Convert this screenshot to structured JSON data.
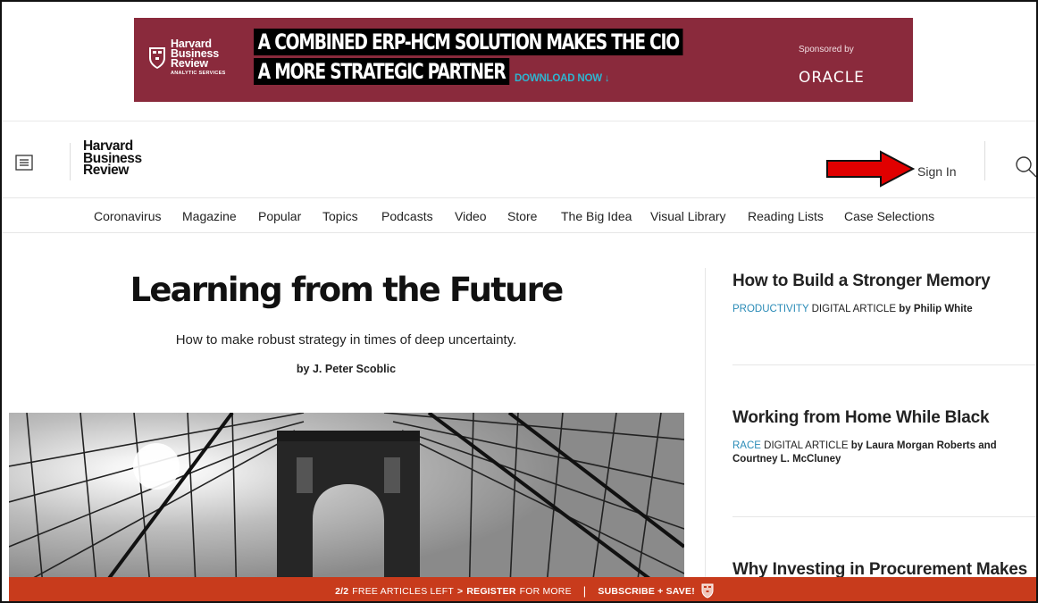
{
  "ad": {
    "logo_lines": [
      "Harvard",
      "Business",
      "Review"
    ],
    "logo_sub": "ANALYTIC SERVICES",
    "headline_line1": "A COMBINED ERP-HCM SOLUTION MAKES THE CIO",
    "headline_line2": "A MORE STRATEGIC PARTNER",
    "cta": "DOWNLOAD NOW ↓",
    "sponsored_by": "Sponsored by",
    "sponsor": "ORACLE",
    "bg_color": "#8a2a3c",
    "cta_color": "#2eb5d0"
  },
  "header": {
    "logo_lines": [
      "Harvard",
      "Business",
      "Review"
    ],
    "sign_in": "Sign In",
    "annotation_arrow_color": "#e00000"
  },
  "nav": {
    "items": [
      {
        "label": "Coronavirus"
      },
      {
        "label": "Magazine"
      },
      {
        "label": "Popular"
      },
      {
        "label": "Topics"
      },
      {
        "label": "Podcasts"
      },
      {
        "label": "Video"
      },
      {
        "label": "Store"
      },
      {
        "label": "The Big Idea"
      },
      {
        "label": "Visual Library"
      },
      {
        "label": "Reading Lists"
      },
      {
        "label": "Case Selections"
      }
    ]
  },
  "feature": {
    "title": "Learning from the Future",
    "dek": "How to make robust strategy in times of deep uncertainty.",
    "byline": "by J. Peter Scoblic"
  },
  "stories": [
    {
      "title": "How to Build a Stronger Memory",
      "tag": "PRODUCTIVITY",
      "type": "DIGITAL ARTICLE",
      "author": "by Philip White"
    },
    {
      "title": "Working from Home While Black",
      "tag": "RACE",
      "type": "DIGITAL ARTICLE",
      "author": "by Laura Morgan Roberts and Courtney L. McCluney"
    },
    {
      "title": "Why Investing in Procurement Makes"
    }
  ],
  "paywall": {
    "count": "2/2",
    "left_text": "FREE ARTICLES LEFT",
    "chevron": ">",
    "register": "REGISTER",
    "for_more": "FOR MORE",
    "pipe": "|",
    "subscribe": "SUBSCRIBE + SAVE!",
    "bg_color": "#c83b1c"
  }
}
